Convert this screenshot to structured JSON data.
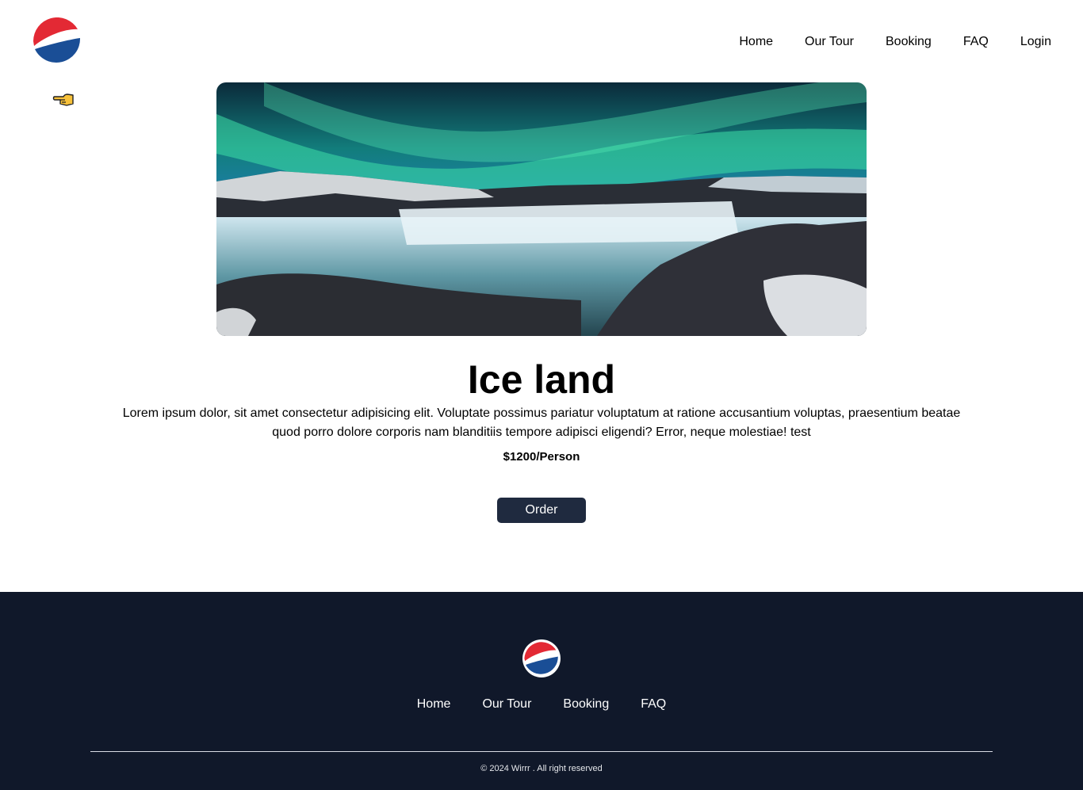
{
  "header": {
    "logo_icon": "pepsi-logo-icon",
    "nav": [
      "Home",
      "Our Tour",
      "Booking",
      "FAQ",
      "Login"
    ]
  },
  "back_icon": "pointing-hand-icon",
  "tour": {
    "title": "Ice land",
    "description": "Lorem ipsum dolor, sit amet consectetur adipisicing elit. Voluptate possimus pariatur voluptatum at ratione accusantium voluptas, praesentium beatae quod porro dolore corporis nam blanditiis tempore adipisci eligendi? Error, neque molestiae! test",
    "price": "$1200/Person",
    "order_label": "Order"
  },
  "footer": {
    "nav": [
      "Home",
      "Our Tour",
      "Booking",
      "FAQ"
    ],
    "copyright": "© 2024 Wirrr . All right reserved"
  },
  "colors": {
    "footer_bg": "#10182a",
    "button_bg": "#1f2a3f",
    "pepsi_red": "#e32934",
    "pepsi_blue": "#1a4e96"
  }
}
